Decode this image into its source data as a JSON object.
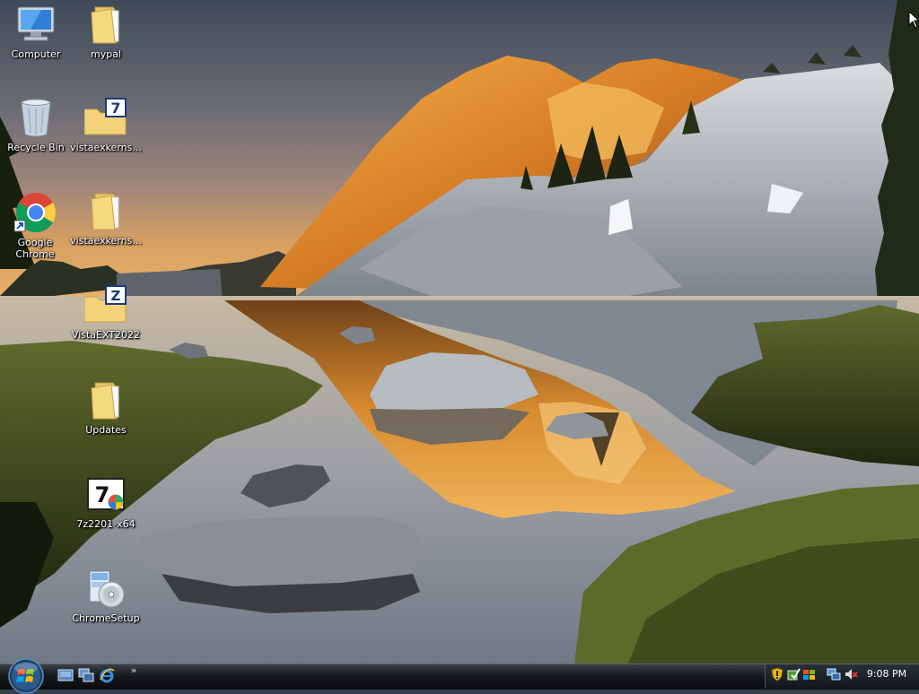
{
  "desktop": {
    "icons": [
      {
        "label": "Computer",
        "icon": "computer-icon"
      },
      {
        "label": "mypal",
        "icon": "folder-icon"
      },
      {
        "label": "Recycle Bin",
        "icon": "recycle-bin-icon"
      },
      {
        "label": "vistaexkerns...",
        "icon": "7zip-archive-icon"
      },
      {
        "label": "Google Chrome",
        "icon": "chrome-icon"
      },
      {
        "label": "vistaexkerns...",
        "icon": "folder-icon"
      },
      {
        "label": "VistaEXT2022",
        "icon": "zip-archive-icon"
      },
      {
        "label": "Updates",
        "icon": "folder-icon"
      },
      {
        "label": "7z2201-x64",
        "icon": "7zip-installer-icon"
      },
      {
        "label": "ChromeSetup",
        "icon": "setup-installer-icon"
      }
    ],
    "wallpaper": "mountain-lake-sunset"
  },
  "taskbar": {
    "start_button": "windows-orb-icon",
    "quick_launch": [
      "show-desktop-icon",
      "switch-windows-icon",
      "internet-explorer-icon"
    ],
    "quick_launch_more": "»",
    "tray_icons": [
      "security-shield-icon",
      "windows-update-icon",
      "action-center-icon",
      "network-icon",
      "volume-muted-icon"
    ],
    "clock": "9:08 PM"
  },
  "colors": {
    "folder": "#f3d37a",
    "taskbar": "#16191c",
    "sky_top": "#4c5a6a",
    "sky_horizon": "#e3a04a"
  }
}
